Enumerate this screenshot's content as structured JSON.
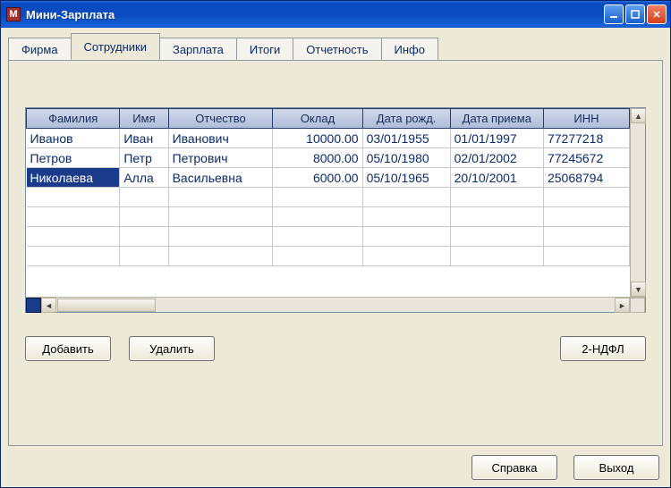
{
  "window": {
    "title": "Мини-Зарплата",
    "icon_letter": "M"
  },
  "tabs": [
    {
      "label": "Фирма"
    },
    {
      "label": "Сотрудники"
    },
    {
      "label": "Зарплата"
    },
    {
      "label": "Итоги"
    },
    {
      "label": "Отчетность"
    },
    {
      "label": "Инфо"
    }
  ],
  "grid": {
    "columns": [
      {
        "label": "Фамилия"
      },
      {
        "label": "Имя"
      },
      {
        "label": "Отчество"
      },
      {
        "label": "Оклад"
      },
      {
        "label": "Дата рожд."
      },
      {
        "label": "Дата приема"
      },
      {
        "label": "ИНН"
      }
    ],
    "rows": [
      {
        "lastname": "Иванов",
        "firstname": "Иван",
        "patronymic": "Иванович",
        "salary": "10000.00",
        "birth": "03/01/1955",
        "hire": "01/01/1997",
        "inn": "77277218"
      },
      {
        "lastname": "Петров",
        "firstname": "Петр",
        "patronymic": "Петрович",
        "salary": "8000.00",
        "birth": "05/10/1980",
        "hire": "02/01/2002",
        "inn": "77245672"
      },
      {
        "lastname": "Николаева",
        "firstname": "Алла",
        "patronymic": "Васильевна",
        "salary": "6000.00",
        "birth": "05/10/1965",
        "hire": "20/10/2001",
        "inn": "25068794"
      }
    ]
  },
  "buttons": {
    "add": "Добавить",
    "delete": "Удалить",
    "ndfl": "2-НДФЛ",
    "help": "Справка",
    "exit": "Выход"
  }
}
